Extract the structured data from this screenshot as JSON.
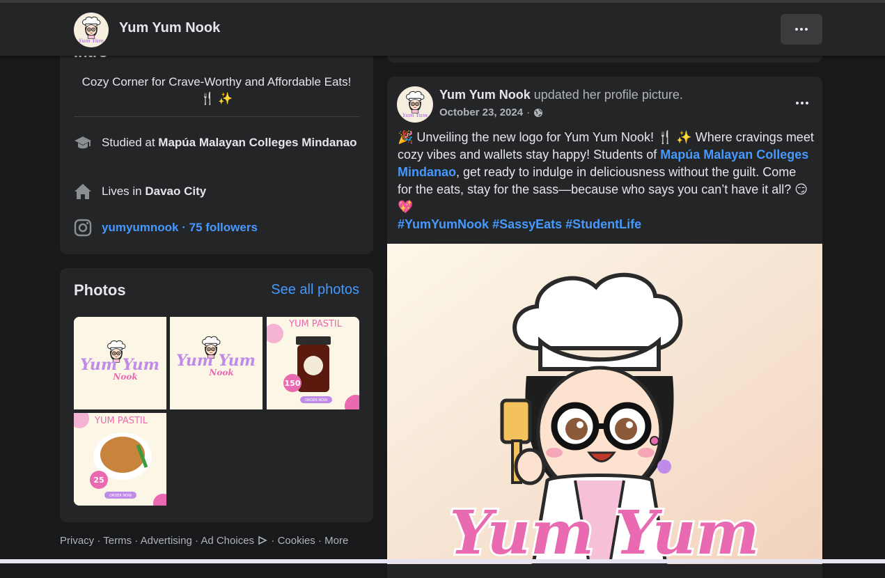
{
  "header": {
    "page_name": "Yum Yum Nook",
    "more_label": "•••"
  },
  "intro": {
    "title": "Intro",
    "bio": "Cozy Corner for Crave-Worthy and Affordable Eats! 🍴 ✨",
    "education_prefix": "Studied at ",
    "education_school": "Mapúa Malayan Colleges Mindanao",
    "location_prefix": "Lives in ",
    "location_city": "Davao City",
    "instagram_handle": "yumyumnook",
    "instagram_followers": " · 75 followers"
  },
  "photos": {
    "title": "Photos",
    "see_all": "See all photos",
    "items": [
      {
        "logo_text": "Yum Yum",
        "logo_sub": "Nook"
      },
      {
        "logo_text": "Yum Yum",
        "logo_sub": "Nook"
      },
      {
        "header": "YUM PASTIL",
        "price": "150",
        "cta": "ORDER NOW"
      },
      {
        "header": "YUM PASTIL",
        "price": "25",
        "cta": "ORDER NOW"
      }
    ]
  },
  "footer": {
    "privacy": "Privacy",
    "terms": "Terms",
    "advertising": "Advertising",
    "ad_choices": "Ad Choices",
    "cookies": "Cookies",
    "more": "More",
    "sep": " · "
  },
  "post": {
    "author": "Yum Yum Nook",
    "action": " updated her profile picture.",
    "date": "October 23, 2024",
    "date_sep": "·",
    "text_part1": "🎉 Unveiling the new logo for Yum Yum Nook! 🍴 ✨ Where cravings meet cozy vibes and wallets stay happy! Students of ",
    "text_link": "Mapúa Malayan Colleges Mindanao",
    "text_part2": ", get ready to indulge in deliciousness without the guilt. Come for the eats, stay for the sass—because who says you can’t have it all? 😏💖",
    "hashtags": [
      "#YumYumNook",
      "#SassyEats",
      "#StudentLife"
    ],
    "image_logo_text": "Yum Yum"
  },
  "colors": {
    "background": "#18191a",
    "card": "#242526",
    "link": "#4599ff",
    "logo_pink": "#e96ab0",
    "logo_purple": "#c08be8"
  },
  "icons": [
    "graduation-cap-icon",
    "home-icon",
    "instagram-icon",
    "globe-icon",
    "more-dots-icon",
    "ad-choices-icon"
  ]
}
